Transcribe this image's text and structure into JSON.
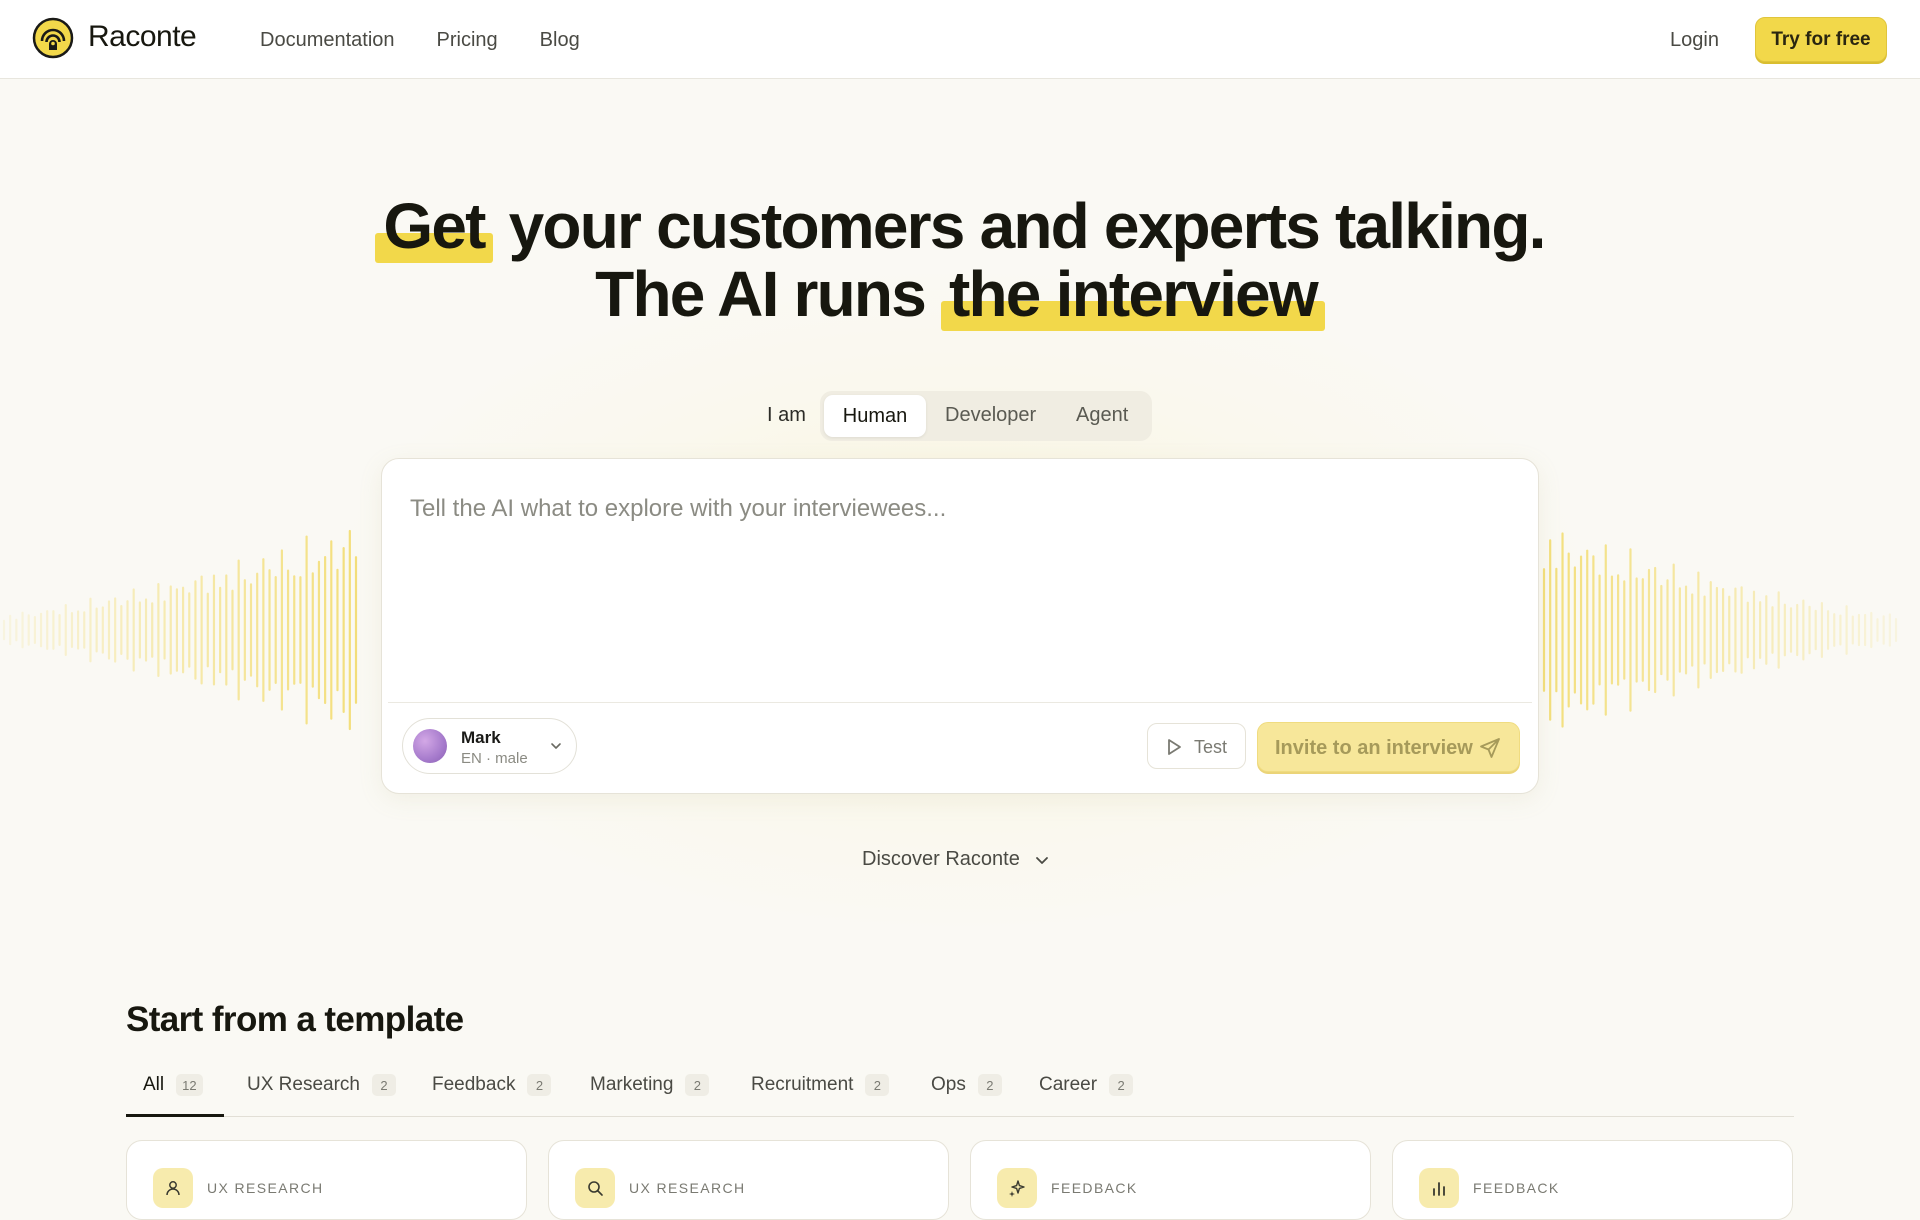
{
  "header": {
    "brand": "Raconte",
    "nav": [
      "Documentation",
      "Pricing",
      "Blog"
    ],
    "login": "Login",
    "cta": "Try for free"
  },
  "hero": {
    "line1_highlight": "Get",
    "line1_rest": "your customers and experts talking.",
    "line2_start": "The AI runs",
    "line2_highlight": "the interview"
  },
  "mode": {
    "label": "I am",
    "options": [
      "Human",
      "Developer",
      "Agent"
    ],
    "selected": "Human"
  },
  "prompt": {
    "placeholder": "Tell the AI what to explore with your interviewees...",
    "value": ""
  },
  "voice": {
    "name": "Mark",
    "meta": "EN · male"
  },
  "actions": {
    "test": "Test",
    "invite": "Invite to an interview"
  },
  "discover": "Discover Raconte",
  "templates": {
    "title": "Start from a template",
    "tabs": [
      {
        "label": "All",
        "count": "12"
      },
      {
        "label": "UX Research",
        "count": "2"
      },
      {
        "label": "Feedback",
        "count": "2"
      },
      {
        "label": "Marketing",
        "count": "2"
      },
      {
        "label": "Recruitment",
        "count": "2"
      },
      {
        "label": "Ops",
        "count": "2"
      },
      {
        "label": "Career",
        "count": "2"
      }
    ],
    "cards": [
      {
        "category": "UX RESEARCH",
        "icon": "user-icon"
      },
      {
        "category": "UX RESEARCH",
        "icon": "search-icon"
      },
      {
        "category": "FEEDBACK",
        "icon": "sparkles-icon"
      },
      {
        "category": "FEEDBACK",
        "icon": "bar-chart-icon"
      }
    ]
  },
  "colors": {
    "accent": "#f2d84a",
    "background": "#faf9f4",
    "text": "#17170f"
  }
}
